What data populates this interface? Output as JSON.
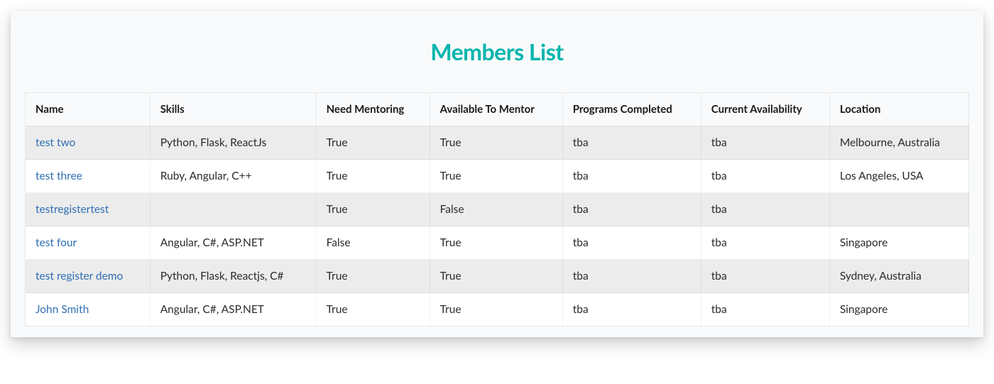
{
  "title": "Members List",
  "table": {
    "headers": [
      "Name",
      "Skills",
      "Need Mentoring",
      "Available To Mentor",
      "Programs Completed",
      "Current Availability",
      "Location"
    ],
    "rows": [
      {
        "name": "test two",
        "skills": "Python, Flask, ReactJs",
        "need_mentoring": "True",
        "available_to_mentor": "True",
        "programs_completed": "tba",
        "current_availability": "tba",
        "location": "Melbourne, Australia"
      },
      {
        "name": "test three",
        "skills": "Ruby, Angular, C++",
        "need_mentoring": "True",
        "available_to_mentor": "True",
        "programs_completed": "tba",
        "current_availability": "tba",
        "location": "Los Angeles, USA"
      },
      {
        "name": "testregistertest",
        "skills": "",
        "need_mentoring": "True",
        "available_to_mentor": "False",
        "programs_completed": "tba",
        "current_availability": "tba",
        "location": ""
      },
      {
        "name": "test four",
        "skills": "Angular, C#, ASP.NET",
        "need_mentoring": "False",
        "available_to_mentor": "True",
        "programs_completed": "tba",
        "current_availability": "tba",
        "location": "Singapore"
      },
      {
        "name": "test register demo",
        "skills": "Python, Flask, Reactjs, C#",
        "need_mentoring": "True",
        "available_to_mentor": "True",
        "programs_completed": "tba",
        "current_availability": "tba",
        "location": "Sydney, Australia"
      },
      {
        "name": "John Smith",
        "skills": "Angular, C#, ASP.NET",
        "need_mentoring": "True",
        "available_to_mentor": "True",
        "programs_completed": "tba",
        "current_availability": "tba",
        "location": "Singapore"
      }
    ]
  }
}
